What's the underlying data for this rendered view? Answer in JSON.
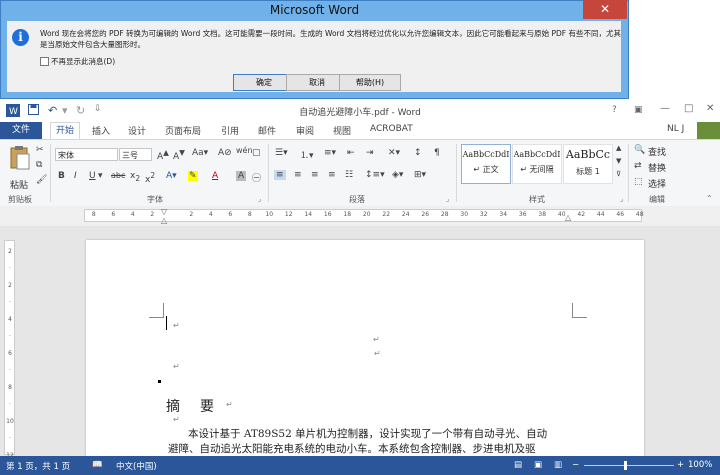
{
  "dialog": {
    "title": "Microsoft Word",
    "close": "✕",
    "message": "Word 现在会将您的 PDF 转换为可编辑的 Word 文档。这可能需要一段时间。生成的 Word 文档将经过优化以允许您编辑文本，因此它可能看起来与原始 PDF 有些不同，尤其是当原始文件包含大量图形时。",
    "checkbox_label": "不再显示此消息(D)",
    "ok": "确定",
    "cancel": "取消",
    "help": "帮助(H)",
    "icon": "info-icon"
  },
  "window": {
    "title": "自动追光避障小车.pdf - Word",
    "user": "NL J",
    "qat": [
      "save-icon",
      "undo-icon",
      "redo-icon",
      "customize-icon"
    ]
  },
  "tabs": [
    "文件",
    "开始",
    "插入",
    "设计",
    "页面布局",
    "引用",
    "邮件",
    "审阅",
    "视图",
    "ACROBAT"
  ],
  "ribbon": {
    "clipboard": {
      "paste": "粘贴",
      "label": "剪贴板"
    },
    "font": {
      "name": "宋体",
      "size": "三号",
      "label": "字体"
    },
    "paragraph": {
      "label": "段落"
    },
    "styles": {
      "label": "样式",
      "items": [
        {
          "preview": "AaBbCcDdI",
          "name": "↵ 正文"
        },
        {
          "preview": "AaBbCcDdI",
          "name": "↵ 无间隔"
        },
        {
          "preview": "AaBbCc",
          "name": "标题 1"
        }
      ]
    },
    "editing": {
      "find": "查找",
      "replace": "替换",
      "select": "选择",
      "label": "编辑"
    }
  },
  "ruler": [
    "8",
    "6",
    "4",
    "2",
    "",
    "2",
    "4",
    "6",
    "8",
    "10",
    "12",
    "14",
    "16",
    "18",
    "20",
    "22",
    "24",
    "26",
    "28",
    "30",
    "32",
    "34",
    "36",
    "38",
    "40",
    "42",
    "44",
    "46",
    "48"
  ],
  "vruler": [
    "2",
    "",
    "2",
    "",
    "4",
    "",
    "6",
    "",
    "8",
    "",
    "10",
    "",
    "12"
  ],
  "document": {
    "heading": "摘要",
    "para_mark": "↵",
    "lines": [
      "本设计基于 AT89S52 单片机为控制器，设计实现了一个带有自动寻光、自动",
      "避障、自动追光太阳能充电系统的电动小车。本系统包含控制器、步进电机及驱"
    ]
  },
  "status": {
    "page": "第 1 页，共 1 页",
    "language": "中文(中国)",
    "zoom": "100%"
  }
}
